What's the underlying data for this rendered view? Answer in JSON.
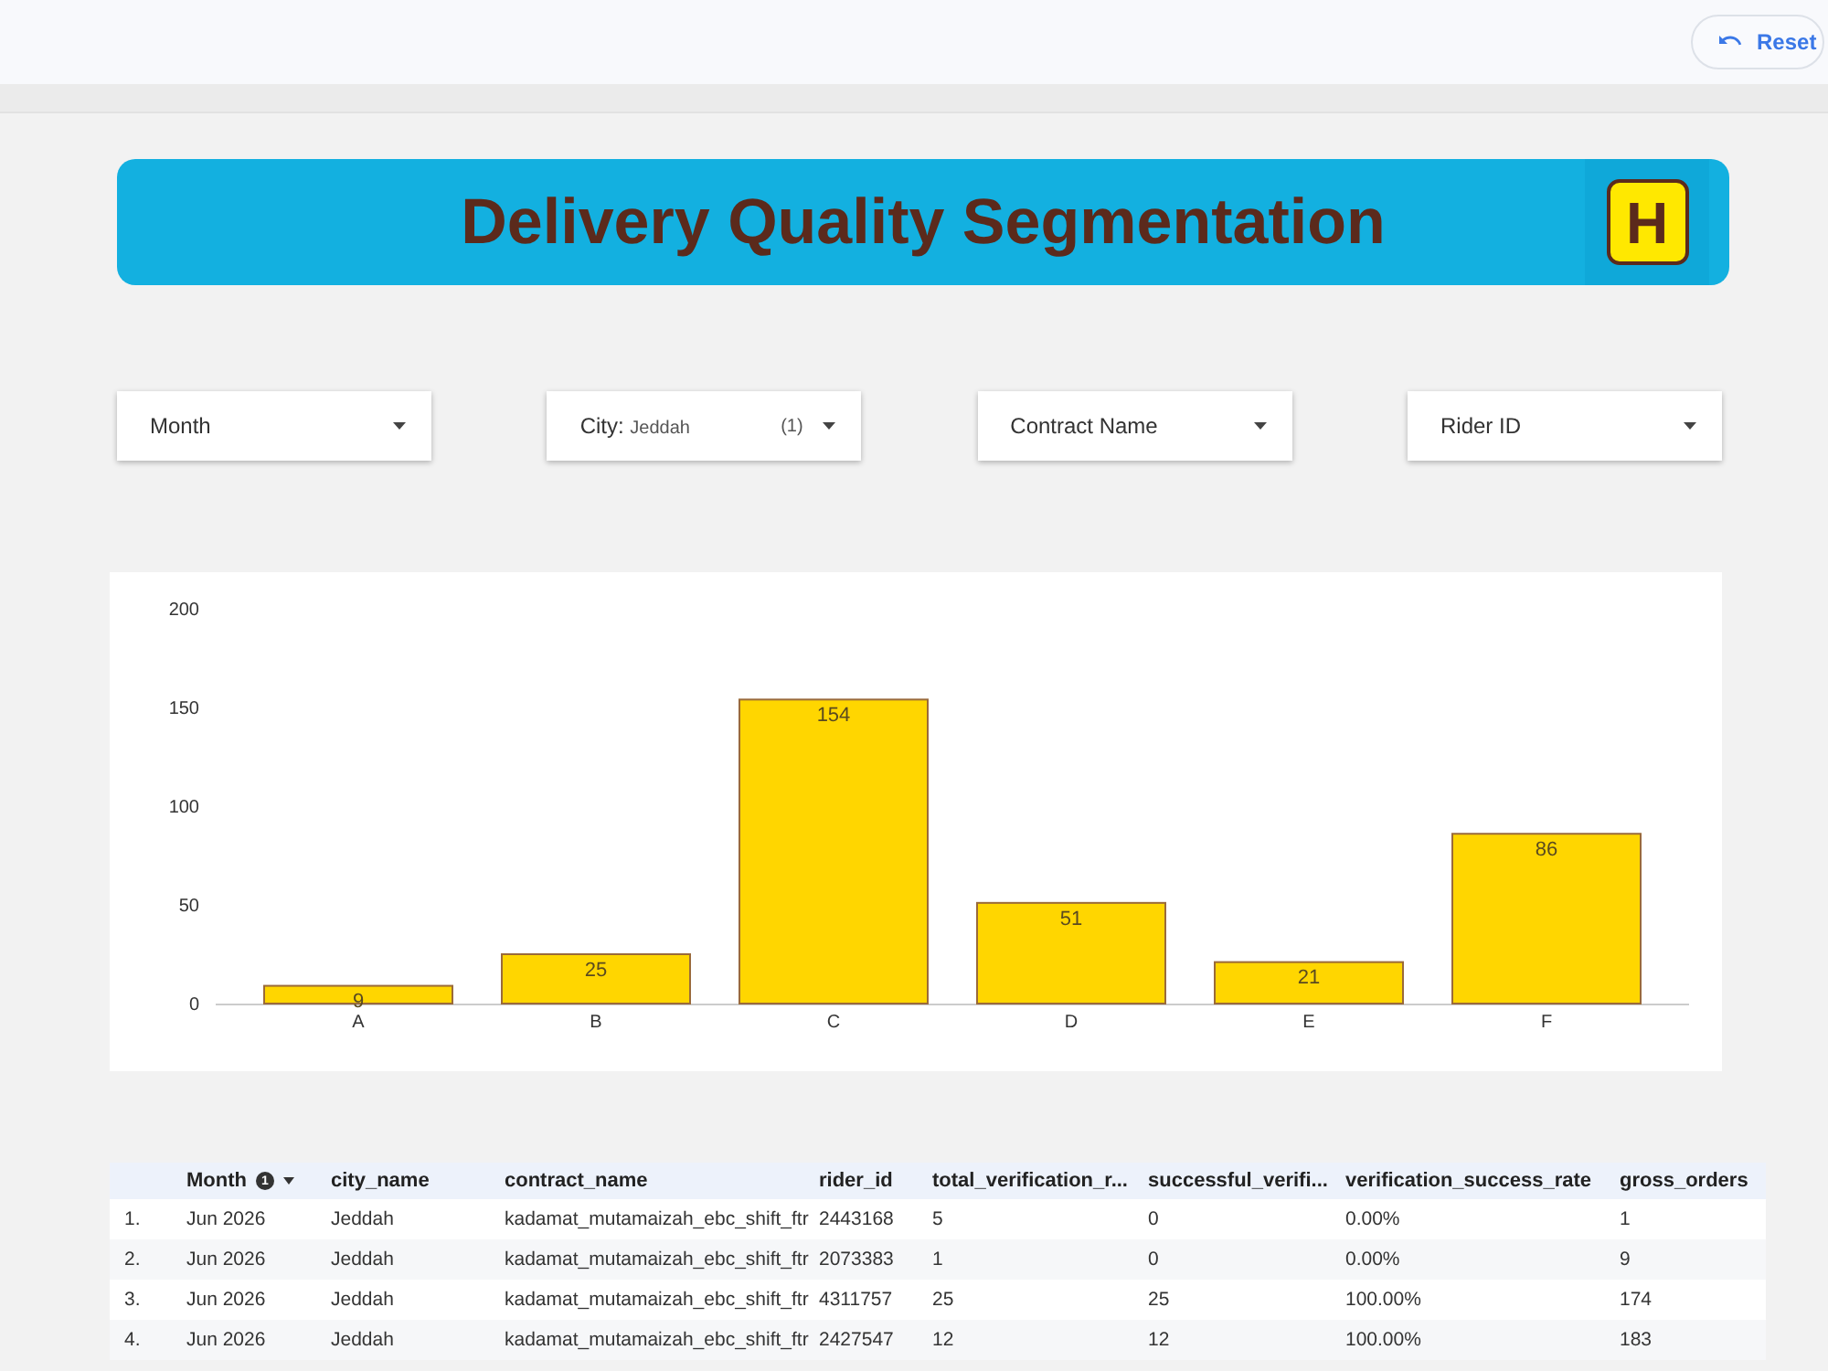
{
  "top_bar": {
    "reset_button": {
      "label": "Reset"
    }
  },
  "banner": {
    "title": "Delivery Quality Segmentation",
    "logo_letter": "H"
  },
  "filters": [
    {
      "label": "Month"
    },
    {
      "label": "City:",
      "value": "Jeddah",
      "count": "(1)"
    },
    {
      "label": "Contract Name"
    },
    {
      "label": "Rider ID"
    }
  ],
  "chart": {
    "chart_data": {
      "type": "bar",
      "categories": [
        "A",
        "B",
        "C",
        "D",
        "E",
        "F"
      ],
      "series": [
        {
          "color": "#ffd600",
          "values": [
            9,
            25,
            154,
            51,
            21,
            86
          ]
        }
      ],
      "ylim": [
        0,
        200
      ],
      "yticks": [
        0,
        50,
        100,
        150,
        200
      ],
      "data_labels": true
    }
  },
  "table": {
    "columns": [
      {
        "label": "Month",
        "sorted": true,
        "descending": true,
        "sort_order": "1"
      },
      {
        "label": "city_name",
        "sorted": false
      },
      {
        "label": "contract_name",
        "sorted": false
      },
      {
        "label": "rider_id",
        "sorted": false
      },
      {
        "label": "total_verification_r...",
        "sorted": false
      },
      {
        "label": "successful_verifi...",
        "sorted": false
      },
      {
        "label": "verification_success_rate",
        "sorted": false
      },
      {
        "label": "gross_orders",
        "sorted": false
      }
    ],
    "rows": [
      {
        "index": "1.",
        "cells": [
          "Jun 2026",
          "Jeddah",
          "kadamat_mutamaizah_ebc_shift_ftr",
          "2443168",
          "5",
          "0",
          "0.00%",
          "1"
        ]
      },
      {
        "index": "2.",
        "cells": [
          "Jun 2026",
          "Jeddah",
          "kadamat_mutamaizah_ebc_shift_ftr",
          "2073383",
          "1",
          "0",
          "0.00%",
          "9"
        ]
      },
      {
        "index": "3.",
        "cells": [
          "Jun 2026",
          "Jeddah",
          "kadamat_mutamaizah_ebc_shift_ftr",
          "4311757",
          "25",
          "25",
          "100.00%",
          "174"
        ]
      },
      {
        "index": "4.",
        "cells": [
          "Jun 2026",
          "Jeddah",
          "kadamat_mutamaizah_ebc_shift_ftr",
          "2427547",
          "12",
          "12",
          "100.00%",
          "183"
        ]
      }
    ]
  }
}
